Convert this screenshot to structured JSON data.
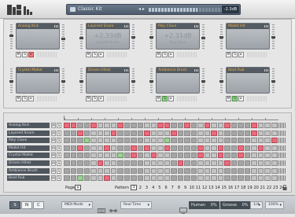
{
  "topbar": {
    "kit_name": "Classic Kit",
    "arrows": "◂ ▸",
    "volume_db": "-2.3dB",
    "volume_level": 0.62
  },
  "pads": [
    {
      "name": "Analog Kick",
      "num": "",
      "sub": "",
      "solo": false,
      "mute_red": true,
      "l": 0.55,
      "r": 0.4
    },
    {
      "name": "Layered Snare",
      "num": "+2.33dB",
      "sub": "Layered Snare",
      "solo": false,
      "mute_red": false,
      "l": 0.45,
      "r": 0.5
    },
    {
      "name": "Poly Clave",
      "num": "+2.31dB",
      "sub": "Poly Clave",
      "solo": false,
      "mute_red": false,
      "l": 0.5,
      "r": 0.45
    },
    {
      "name": "Mallet Hit",
      "num": "",
      "sub": "",
      "solo": false,
      "mute_red": false,
      "l": 0.5,
      "r": 0.5
    },
    {
      "name": "Crystal Mallet",
      "num": "",
      "sub": "",
      "solo": false,
      "mute_red": false,
      "l": 0.5,
      "r": 0.5
    },
    {
      "name": "Driven Hihat",
      "num": "",
      "sub": "",
      "solo": false,
      "mute_red": false,
      "l": 0.5,
      "r": 0.5
    },
    {
      "name": "Ambience Brush",
      "num": "",
      "sub": "",
      "solo": true,
      "mute_red": false,
      "l": 0.5,
      "r": 0.5
    },
    {
      "name": "Beat Rub",
      "num": "",
      "sub": "",
      "solo": true,
      "mute_red": false,
      "l": 0.5,
      "r": 0.5
    }
  ],
  "pad_buttons": {
    "m": "M",
    "s": "S",
    "play": "▸",
    "extra": "○"
  },
  "sequencer": {
    "rows": [
      {
        "label": "Analog Kick",
        "cells": "xx..x...x.....xx..x..x..x...x..."
      },
      {
        "label": "Layered Snare",
        "cells": "..x....x....x...x.....x.....x..."
      },
      {
        "label": "Poly Clave",
        "cells": "...g...........g...............x"
      },
      {
        "label": "Mallet Hit",
        "cells": "..x...x...x.x..x....x..x..x..x.."
      },
      {
        "label": "Crystal Mallet",
        "cells": "........g.x..x......x..x..x....."
      },
      {
        "label": "Driven Hihat",
        "cells": ".....x...........x......x......."
      },
      {
        "label": "Ambience Brush",
        "cells": "................................"
      },
      {
        "label": "Beat Rub",
        "cells": "..g...x........................."
      }
    ],
    "ms_m": "M",
    "ms_s": "S",
    "page_label": "Page",
    "page_btn": "A",
    "pattern_label": "Pattern",
    "pattern_numbers": [
      "1",
      "2",
      "3",
      "4",
      "5",
      "6",
      "7",
      "8",
      "9",
      "10",
      "11",
      "12",
      "13",
      "14",
      "15",
      "16",
      "17",
      "18",
      "19",
      "20",
      "21",
      "22",
      "23",
      "24"
    ],
    "pattern_selected": "1"
  },
  "bottombar": {
    "snc": [
      "S",
      "N",
      "C"
    ],
    "midi_mode": "MIDI Mode",
    "real_time": "Real Time",
    "human_label": "Human",
    "human_value": "0%",
    "groove_label": "Groove",
    "groove_value": "0%",
    "swing": "1/4",
    "zoom": "100%"
  }
}
